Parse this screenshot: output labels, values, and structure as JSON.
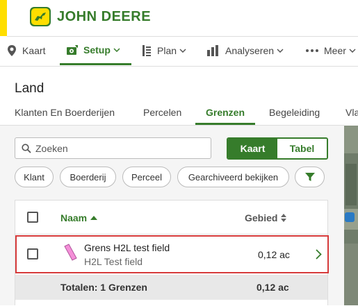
{
  "brand": {
    "name": "JOHN DEERE",
    "primary_color": "#367C2B",
    "accent_color": "#FFDE00"
  },
  "nav": {
    "items": [
      {
        "label": "Kaart",
        "icon": "map-pin-icon"
      },
      {
        "label": "Setup",
        "icon": "gear-icon",
        "active": true
      },
      {
        "label": "Plan",
        "icon": "plan-icon"
      },
      {
        "label": "Analyseren",
        "icon": "bar-chart-icon"
      },
      {
        "label": "Meer",
        "icon": "more-dots-icon"
      }
    ]
  },
  "page": {
    "title": "Land"
  },
  "tabs": [
    {
      "label": "Klanten En Boerderijen"
    },
    {
      "label": "Percelen"
    },
    {
      "label": "Grenzen",
      "active": true
    },
    {
      "label": "Begeleiding"
    },
    {
      "label": "Vla"
    }
  ],
  "search": {
    "placeholder": "Zoeken"
  },
  "view_toggle": {
    "map_label": "Kaart",
    "table_label": "Tabel",
    "selected": "Kaart"
  },
  "filters": {
    "chips": [
      {
        "label": "Klant"
      },
      {
        "label": "Boerderij"
      },
      {
        "label": "Perceel"
      },
      {
        "label": "Gearchiveerd bekijken"
      }
    ]
  },
  "table": {
    "columns": {
      "name": "Naam",
      "area": "Gebied"
    },
    "rows": [
      {
        "title": "Grens H2L test field",
        "subtitle": "H2L Test field",
        "area": "0,12 ac",
        "shape_color": "#F48FD8"
      }
    ],
    "totals": {
      "label": "Totalen: 1 Grenzen",
      "area": "0,12 ac"
    }
  }
}
